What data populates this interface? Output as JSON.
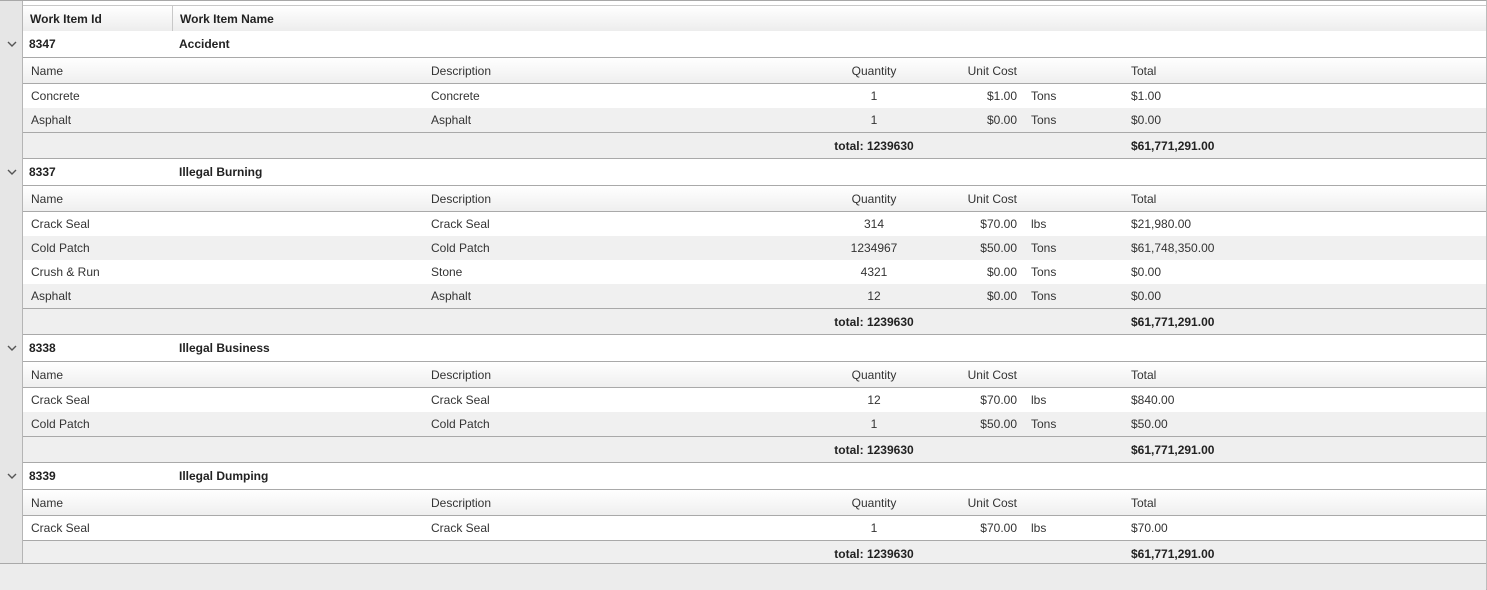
{
  "header": {
    "col_id": "Work Item Id",
    "col_name": "Work Item Name"
  },
  "sub_header": {
    "name": "Name",
    "description": "Description",
    "quantity": "Quantity",
    "unit_cost": "Unit Cost",
    "total": "Total"
  },
  "groups": [
    {
      "id": "8347",
      "name": "Accident",
      "rows": [
        {
          "name": "Concrete",
          "description": "Concrete",
          "quantity": "1",
          "unit_cost": "$1.00",
          "unit": "Tons",
          "total": "$1.00"
        },
        {
          "name": "Asphalt",
          "description": "Asphalt",
          "quantity": "1",
          "unit_cost": "$0.00",
          "unit": "Tons",
          "total": "$0.00"
        }
      ],
      "footer": {
        "quantity_total": "total: 1239630",
        "grand_total": "$61,771,291.00"
      }
    },
    {
      "id": "8337",
      "name": "Illegal Burning",
      "rows": [
        {
          "name": "Crack Seal",
          "description": "Crack Seal",
          "quantity": "314",
          "unit_cost": "$70.00",
          "unit": "lbs",
          "total": "$21,980.00"
        },
        {
          "name": "Cold Patch",
          "description": "Cold Patch",
          "quantity": "1234967",
          "unit_cost": "$50.00",
          "unit": "Tons",
          "total": "$61,748,350.00"
        },
        {
          "name": "Crush & Run",
          "description": "Stone",
          "quantity": "4321",
          "unit_cost": "$0.00",
          "unit": "Tons",
          "total": "$0.00"
        },
        {
          "name": "Asphalt",
          "description": "Asphalt",
          "quantity": "12",
          "unit_cost": "$0.00",
          "unit": "Tons",
          "total": "$0.00"
        }
      ],
      "footer": {
        "quantity_total": "total: 1239630",
        "grand_total": "$61,771,291.00"
      }
    },
    {
      "id": "8338",
      "name": "Illegal Business",
      "rows": [
        {
          "name": "Crack Seal",
          "description": "Crack Seal",
          "quantity": "12",
          "unit_cost": "$70.00",
          "unit": "lbs",
          "total": "$840.00"
        },
        {
          "name": "Cold Patch",
          "description": "Cold Patch",
          "quantity": "1",
          "unit_cost": "$50.00",
          "unit": "Tons",
          "total": "$50.00"
        }
      ],
      "footer": {
        "quantity_total": "total: 1239630",
        "grand_total": "$61,771,291.00"
      }
    },
    {
      "id": "8339",
      "name": "Illegal Dumping",
      "rows": [
        {
          "name": "Crack Seal",
          "description": "Crack Seal",
          "quantity": "1",
          "unit_cost": "$70.00",
          "unit": "lbs",
          "total": "$70.00"
        }
      ],
      "footer": {
        "quantity_total": "total: 1239630",
        "grand_total": "$61,771,291.00"
      }
    }
  ],
  "icons": {
    "expander": "chevron-down-icon"
  }
}
